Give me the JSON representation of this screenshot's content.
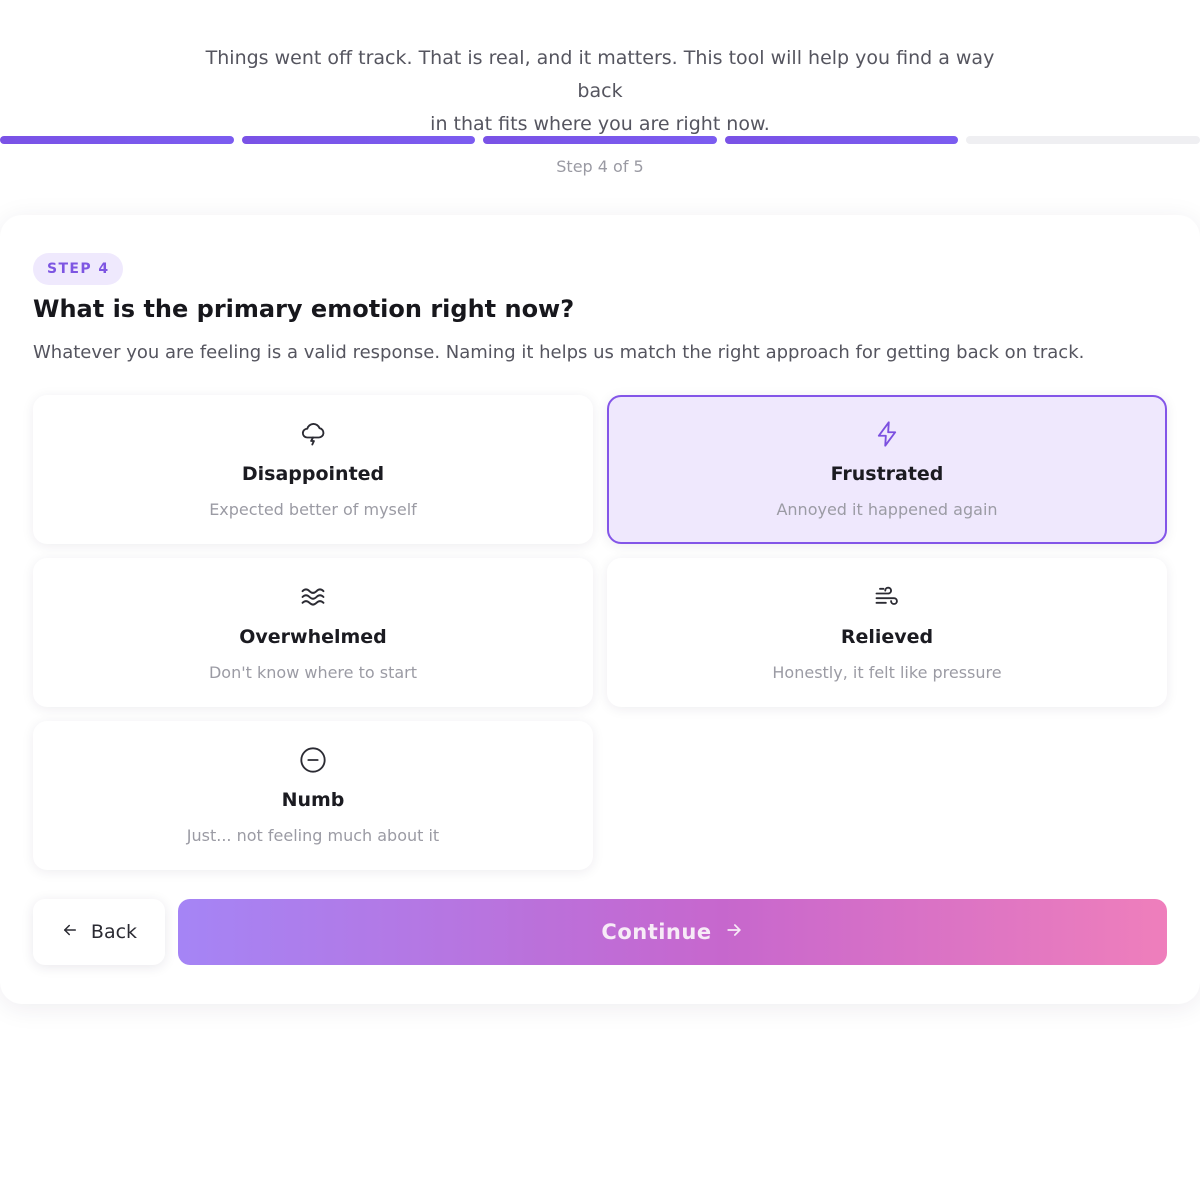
{
  "intro": {
    "line1": "Things went off track. That is real, and it matters. This tool will help you find a way back",
    "line2": "in that fits where you are right now."
  },
  "progress": {
    "current_step": 4,
    "total_steps": 5,
    "label": "Step 4 of 5",
    "accent_color": "#7b56ea"
  },
  "step": {
    "badge": "STEP 4",
    "question": "What is the primary emotion right now?",
    "helper": "Whatever you are feeling is a valid response. Naming it helps us match the right approach for getting back on track."
  },
  "options": [
    {
      "icon": "rain-cloud-icon",
      "label": "Disappointed",
      "description": "Expected better of myself",
      "selected": false
    },
    {
      "icon": "lightning-icon",
      "label": "Frustrated",
      "description": "Annoyed it happened again",
      "selected": true
    },
    {
      "icon": "waves-icon",
      "label": "Overwhelmed",
      "description": "Don't know where to start",
      "selected": false
    },
    {
      "icon": "wind-icon",
      "label": "Relieved",
      "description": "Honestly, it felt like pressure",
      "selected": false
    },
    {
      "icon": "minus-circle-icon",
      "label": "Numb",
      "description": "Just... not feeling much about it",
      "selected": false
    }
  ],
  "actions": {
    "back_label": "Back",
    "continue_label": "Continue"
  }
}
